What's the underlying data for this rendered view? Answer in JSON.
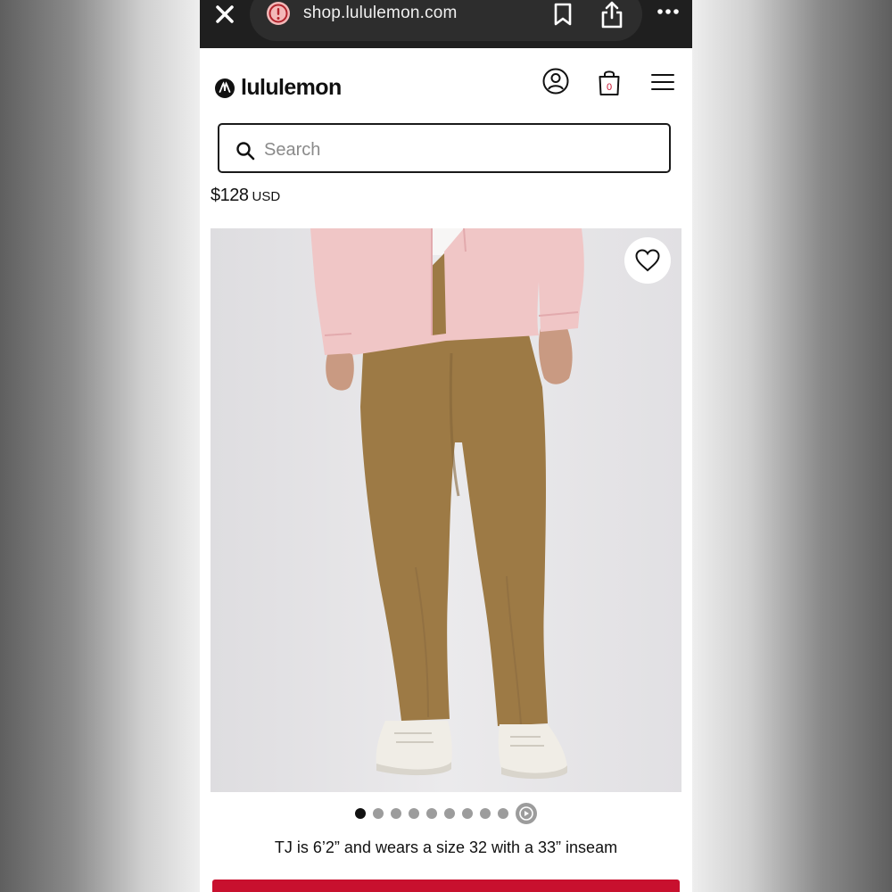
{
  "browser": {
    "url": "shop.lululemon.com",
    "icons": [
      "close-icon",
      "warning-icon",
      "bookmark-icon",
      "share-icon",
      "more-icon"
    ]
  },
  "header": {
    "logo_text": "lululemon",
    "cart_count": "0",
    "icons": [
      "account-icon",
      "shopping-bag-icon",
      "menu-icon"
    ]
  },
  "search": {
    "placeholder": "Search",
    "value": ""
  },
  "product": {
    "price_amount": "$128",
    "price_currency": "USD",
    "image_count": 9,
    "active_image": 1,
    "model_note": "TJ is 6’2” and wears a size 32 with a 33” inseam"
  },
  "colors": {
    "browser_bar": "#1f1f1f",
    "brand_red": "#c8102e",
    "pants": "#9d7a45",
    "shirt": "#f0c6c6",
    "image_bg": "#e5e4e6"
  }
}
